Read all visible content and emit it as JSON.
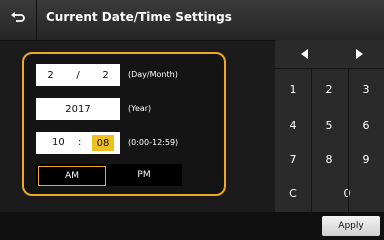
{
  "header": {
    "title": "Current Date/Time Settings",
    "back_icon": "back-arrow-icon"
  },
  "date": {
    "day": "2",
    "separator": "/",
    "month": "2",
    "day_month_label": "(Day/Month)",
    "year": "2017",
    "year_label": "(Year)"
  },
  "time": {
    "hour": "10",
    "colon": ":",
    "minute": "08",
    "range_label": "(0:00-12:59)",
    "am_label": "AM",
    "pm_label": "PM"
  },
  "keypad": {
    "keys": [
      "1",
      "2",
      "3",
      "4",
      "5",
      "6",
      "7",
      "8",
      "9",
      "C",
      "0"
    ],
    "left_icon": "left-arrow-icon",
    "right_icon": "right-arrow-icon"
  },
  "footer": {
    "apply_label": "Apply"
  },
  "colors": {
    "accent": "#f0a828",
    "highlight": "#f0c020"
  }
}
